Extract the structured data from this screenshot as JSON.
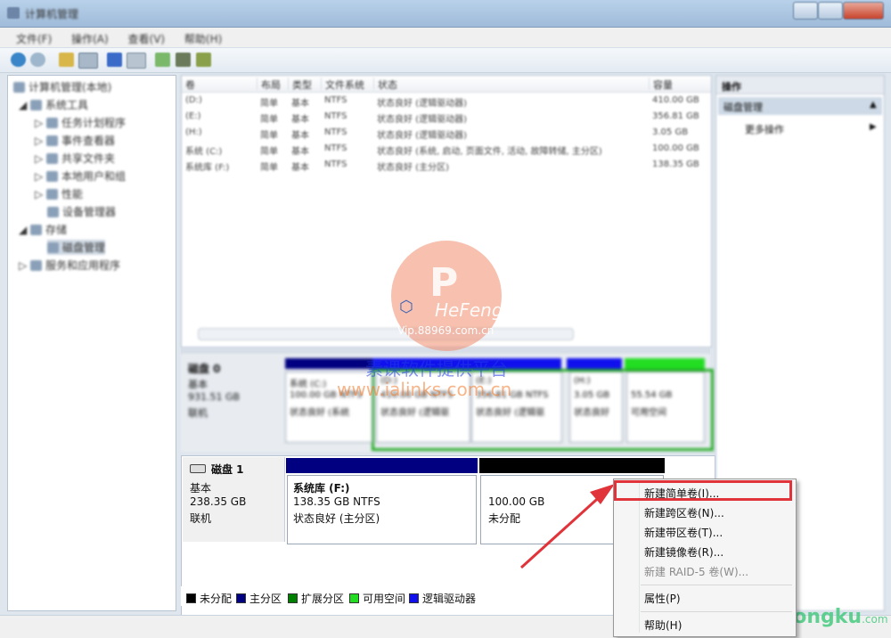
{
  "window": {
    "title": "计算机管理"
  },
  "menu": [
    "文件(F)",
    "操作(A)",
    "查看(V)",
    "帮助(H)"
  ],
  "tree": [
    {
      "label": "计算机管理(本地)",
      "level": 0
    },
    {
      "label": "系统工具",
      "level": 1
    },
    {
      "label": "任务计划程序",
      "level": 2
    },
    {
      "label": "事件查看器",
      "level": 2
    },
    {
      "label": "共享文件夹",
      "level": 2
    },
    {
      "label": "本地用户和组",
      "level": 2
    },
    {
      "label": "性能",
      "level": 2
    },
    {
      "label": "设备管理器",
      "level": 2
    },
    {
      "label": "存储",
      "level": 1
    },
    {
      "label": "磁盘管理",
      "level": 2
    },
    {
      "label": "服务和应用程序",
      "level": 1
    }
  ],
  "volume_list": {
    "columns": [
      "卷",
      "布局",
      "类型",
      "文件系统",
      "状态",
      "容量"
    ],
    "rows": [
      [
        "(D:)",
        "简单",
        "基本",
        "NTFS",
        "状态良好 (逻辑驱动器)",
        "410.00 GB"
      ],
      [
        "(E:)",
        "简单",
        "基本",
        "NTFS",
        "状态良好 (逻辑驱动器)",
        "356.81 GB"
      ],
      [
        "(H:)",
        "简单",
        "基本",
        "NTFS",
        "状态良好 (逻辑驱动器)",
        "3.05 GB"
      ],
      [
        "系统 (C:)",
        "简单",
        "基本",
        "NTFS",
        "状态良好 (系统, 启动, 页面文件, 活动, 故障转储, 主分区)",
        "100.00 GB"
      ],
      [
        "系统库 (F:)",
        "简单",
        "基本",
        "NTFS",
        "状态良好 (主分区)",
        "138.35 GB"
      ]
    ]
  },
  "disk0": {
    "name": "磁盘 0",
    "type": "基本",
    "size": "931.51 GB",
    "status": "联机",
    "volumes": [
      {
        "name": "系统 (C:)",
        "size": "100.00 GB NTFS",
        "status": "状态良好 (系统"
      },
      {
        "name": "(D:)",
        "size": "410.00 GB NTFS",
        "status": "状态良好 (逻辑驱"
      },
      {
        "name": "(E:)",
        "size": "356.81 GB NTFS",
        "status": "状态良好 (逻辑驱"
      },
      {
        "name": "(H:)",
        "size": "3.05 GB",
        "status": "状态良好"
      },
      {
        "name": "",
        "size": "55.54 GB",
        "status": "可用空间"
      }
    ]
  },
  "disk1": {
    "name": "磁盘 1",
    "type": "基本",
    "size": "238.35 GB",
    "status": "联机",
    "vol_f": {
      "name": "系统库  (F:)",
      "size": "138.35 GB NTFS",
      "status": "状态良好 (主分区)"
    },
    "unalloc": {
      "size": "100.00 GB",
      "status": "未分配"
    }
  },
  "legend": [
    {
      "label": "未分配",
      "color": "#000000"
    },
    {
      "label": "主分区",
      "color": "#000080"
    },
    {
      "label": "扩展分区",
      "color": "#008000"
    },
    {
      "label": "可用空间",
      "color": "#22dd22"
    },
    {
      "label": "逻辑驱动器",
      "color": "#1010ee"
    }
  ],
  "actions_pane": {
    "title": "操作",
    "section": "磁盘管理",
    "more": "更多操作"
  },
  "context_menu": {
    "items": [
      {
        "label": "新建简单卷(I)...",
        "enabled": true
      },
      {
        "label": "新建跨区卷(N)...",
        "enabled": true
      },
      {
        "label": "新建带区卷(T)...",
        "enabled": true
      },
      {
        "label": "新建镜像卷(R)...",
        "enabled": true
      },
      {
        "label": "新建 RAID-5 卷(W)...",
        "enabled": false
      },
      {
        "label": "属性(P)",
        "enabled": true
      },
      {
        "label": "帮助(H)",
        "enabled": true
      }
    ]
  },
  "watermarks": {
    "hefeng": "HeFeng",
    "vip": "Vip.88969.com.cn",
    "cn_text": "素课软件提供平台",
    "url": "www.ialinks.com.cn",
    "xitongku": "xitongku",
    "xitongku_suffix": ".com"
  },
  "colors": {
    "highlight": "#e0333a",
    "primary": "#000080",
    "logical": "#1010ee",
    "free": "#22dd22",
    "extended": "#008000"
  }
}
